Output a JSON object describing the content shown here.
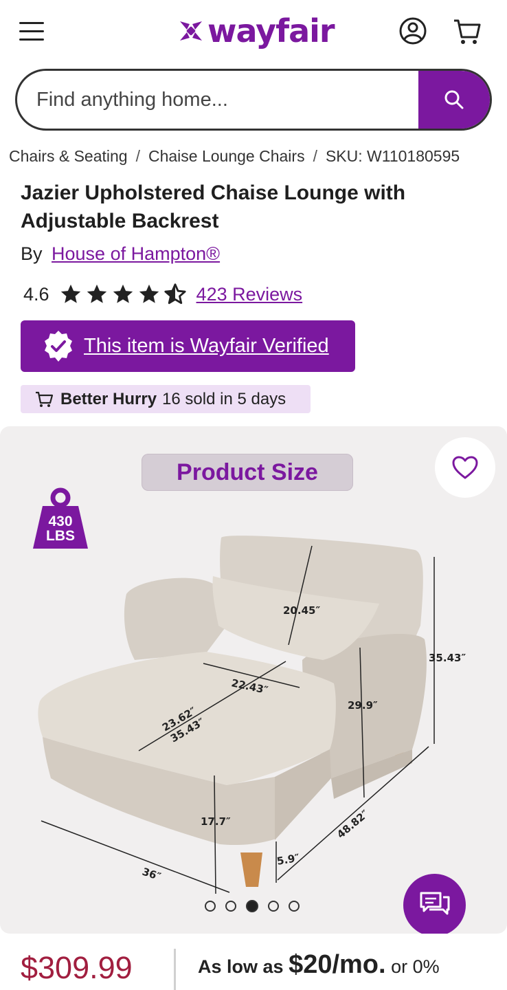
{
  "header": {
    "logo_text": "wayfair",
    "brand_color": "#7b189f",
    "menu_icon": "hamburger-icon",
    "account_icon": "account-icon",
    "cart_icon": "cart-icon"
  },
  "search": {
    "placeholder": "Find anything home...",
    "icon": "search-icon"
  },
  "breadcrumb": {
    "items": [
      "Chairs & Seating",
      "Chaise Lounge Chairs",
      "SKU: W110180595"
    ],
    "separator": "/"
  },
  "product": {
    "title": "Jazier Upholstered Chaise Lounge with Adjustable Backrest",
    "by_label": "By",
    "brand": "House of Hampton®",
    "rating_value": "4.6",
    "rating": 4.6,
    "reviews_label": "423 Reviews",
    "verified_label": "This item is Wayfair Verified",
    "urgency_bold": "Better Hurry",
    "urgency_text": "16 sold in 5 days"
  },
  "gallery": {
    "size_label": "Product Size",
    "weight_line1": "430",
    "weight_line2": "LBS",
    "dims": {
      "back_width": "20.45″",
      "height": "35.43″",
      "seat_width": "22.43″",
      "seat_depth_a": "23.62″",
      "seat_depth_b": "35.43″",
      "arm_height": "29.9″",
      "seat_height": "17.7″",
      "width": "36″",
      "depth": "48.82″",
      "leg": "5.9″"
    },
    "dot_count": 5,
    "active_dot": 3
  },
  "pricing": {
    "price": "$309.99",
    "financing_lead": "As low as",
    "financing_amount": "$20/mo.",
    "financing_tail": "or 0%",
    "price_color": "#a11e3f"
  }
}
